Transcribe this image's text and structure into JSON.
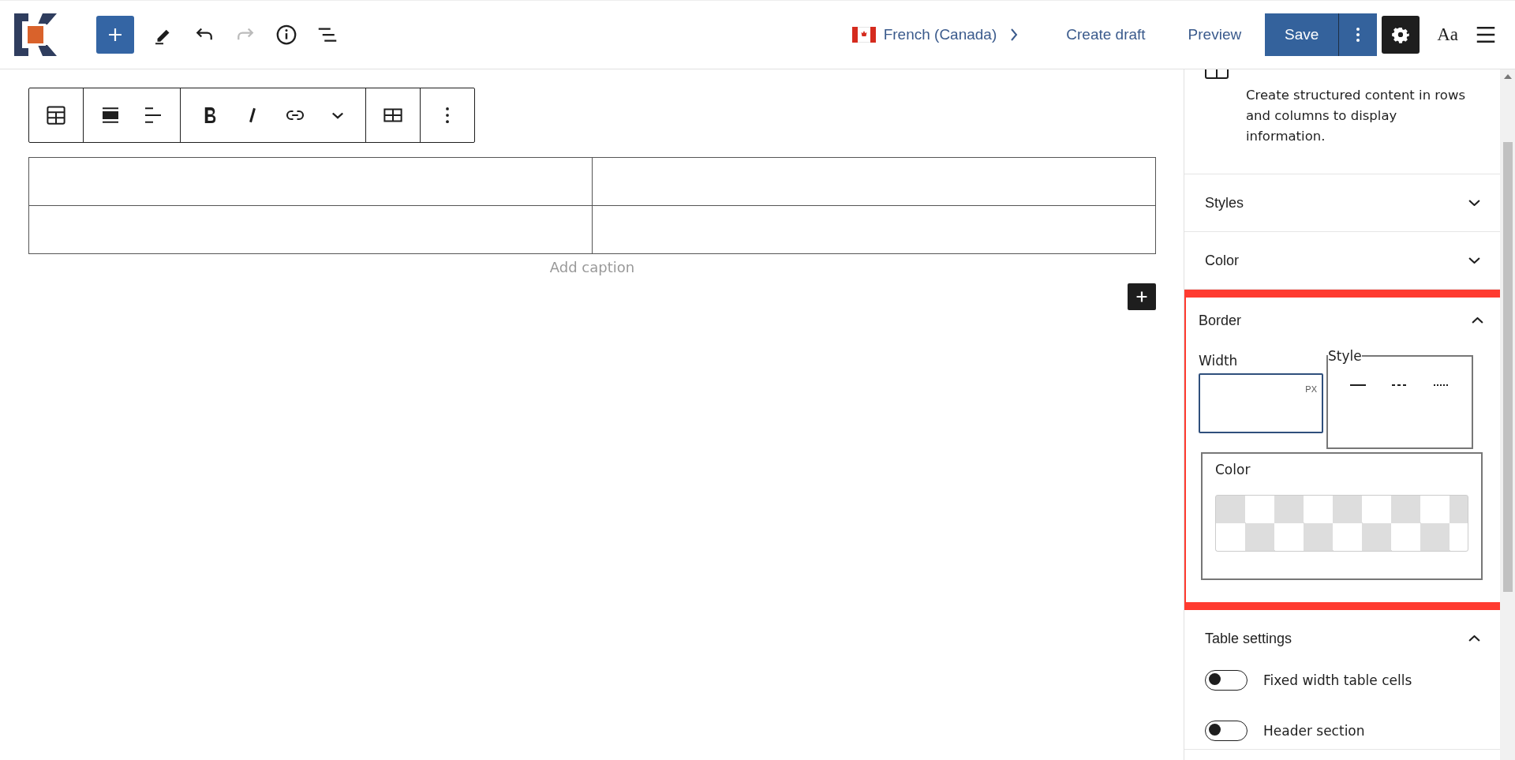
{
  "header": {
    "language": "French (Canada)",
    "actions": [
      "Create draft",
      "Preview"
    ],
    "save": "Save",
    "typography": "Aa"
  },
  "table": {
    "caption_placeholder": "Add caption"
  },
  "sidebar": {
    "description": "Create structured content in rows and columns to display information.",
    "panels": [
      {
        "kind": "plain",
        "title": "Styles",
        "expanded": false,
        "highlighted": false
      },
      {
        "kind": "plain",
        "title": "Color",
        "expanded": false,
        "highlighted": false
      },
      {
        "kind": "border",
        "title": "Border",
        "expanded": true,
        "highlighted": true,
        "width_label": "Width",
        "unit": "PX",
        "style_label": "Style",
        "color_label": "Color"
      },
      {
        "kind": "settings",
        "title": "Table settings",
        "expanded": true,
        "highlighted": false,
        "toggles": [
          {
            "label": "Fixed width table cells",
            "on": false
          },
          {
            "label": "Header section",
            "on": false
          }
        ]
      }
    ]
  }
}
